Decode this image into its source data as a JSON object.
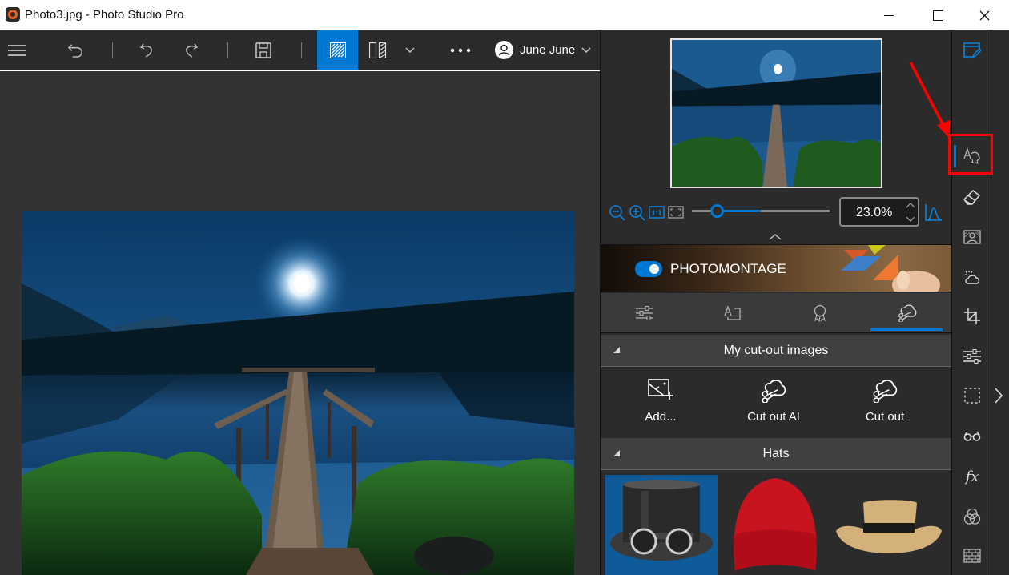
{
  "window": {
    "title": "Photo3.jpg - Photo Studio Pro",
    "controls": [
      "minimize",
      "maximize",
      "close"
    ]
  },
  "toolbar": {
    "items": [
      {
        "name": "menu",
        "icon": "hamburger-icon"
      },
      {
        "name": "undo-all",
        "icon": "undo-all-icon"
      },
      {
        "name": "undo",
        "icon": "undo-icon"
      },
      {
        "name": "redo",
        "icon": "redo-icon"
      },
      {
        "name": "save",
        "icon": "save-icon"
      },
      {
        "name": "view-single",
        "icon": "view-single-icon",
        "active": true
      },
      {
        "name": "view-compare",
        "icon": "split-view-icon"
      },
      {
        "name": "view-options",
        "icon": "chevron-down-icon"
      },
      {
        "name": "more",
        "icon": "more-icon"
      }
    ],
    "user": {
      "name": "June June"
    }
  },
  "navigator": {
    "zoom_value": "23.0%",
    "zoom_slider_fraction": 0.23
  },
  "banner": {
    "label": "PHOTOMONTAGE",
    "toggle_on": true
  },
  "tabs": [
    {
      "name": "adjust",
      "icon": "sliders-icon"
    },
    {
      "name": "text",
      "icon": "text-frame-icon"
    },
    {
      "name": "stickers",
      "icon": "badge-icon"
    },
    {
      "name": "cutout",
      "icon": "cloud-scissors-icon",
      "active": true
    }
  ],
  "sections": {
    "cutout": {
      "title": "My cut-out images",
      "actions": [
        {
          "label": "Add...",
          "icon": "add-image-icon"
        },
        {
          "label": "Cut out AI",
          "icon": "cloud-scissors-icon"
        },
        {
          "label": "Cut out",
          "icon": "cloud-scissors-icon"
        }
      ]
    },
    "hats": {
      "title": "Hats",
      "items": [
        {
          "name": "Top hat with goggles",
          "selected": true
        },
        {
          "name": "Red beanie"
        },
        {
          "name": "Straw cowboy hat"
        }
      ]
    }
  },
  "rail": {
    "items": [
      {
        "name": "edit",
        "icon": "edit-window-icon",
        "accent": true
      },
      {
        "name": "photomontage",
        "icon": "text-sticker-icon",
        "active": true,
        "highlighted": true
      },
      {
        "name": "eraser",
        "icon": "eraser-icon"
      },
      {
        "name": "portrait",
        "icon": "portrait-icon"
      },
      {
        "name": "weather",
        "icon": "weather-icon"
      },
      {
        "name": "crop",
        "icon": "crop-icon"
      },
      {
        "name": "adjustments",
        "icon": "sliders-icon"
      },
      {
        "name": "selection",
        "icon": "selection-icon"
      },
      {
        "name": "glasses",
        "icon": "glasses-icon"
      },
      {
        "name": "effects",
        "icon": "fx-icon"
      },
      {
        "name": "color",
        "icon": "color-circles-icon"
      },
      {
        "name": "texture",
        "icon": "bricks-icon"
      }
    ]
  },
  "colors": {
    "accent": "#0078d4",
    "annotation": "#ff0000",
    "panel_bg": "#2b2b2b",
    "canvas_bg": "#333333"
  }
}
